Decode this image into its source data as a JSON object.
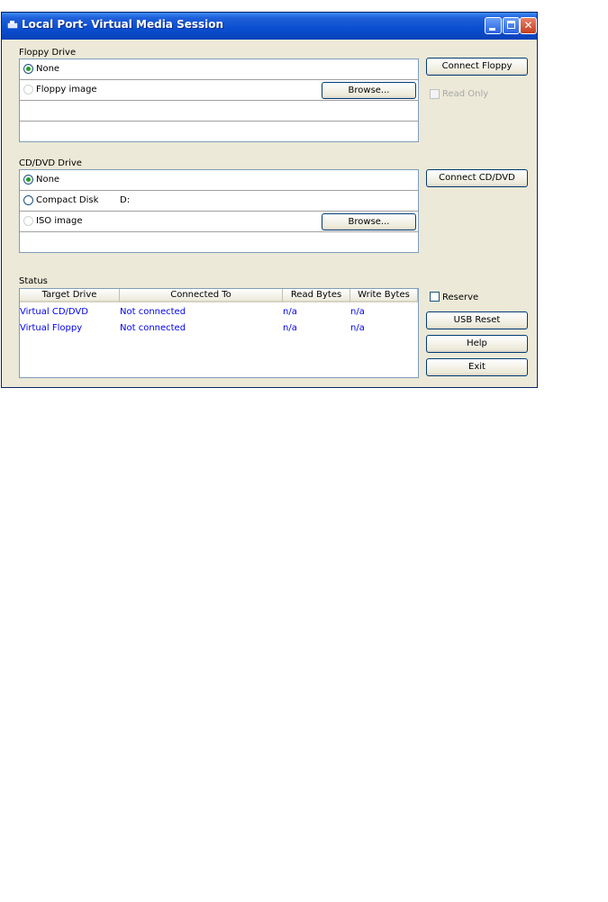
{
  "window": {
    "title": "Local Port- Virtual Media Session",
    "icon": "network-drive-icon"
  },
  "floppy": {
    "group_label": "Floppy Drive",
    "options": [
      {
        "label": "None",
        "selected": true
      },
      {
        "label": "Floppy image",
        "selected": false
      }
    ],
    "browse_label": "Browse...",
    "connect_label": "Connect Floppy",
    "read_only_label": "Read Only",
    "read_only_checked": false,
    "read_only_enabled": false
  },
  "cddvd": {
    "group_label": "CD/DVD Drive",
    "options": [
      {
        "label": "None",
        "selected": true
      },
      {
        "label": "Compact Disk",
        "selected": false,
        "value": "D:"
      },
      {
        "label": "ISO image",
        "selected": false
      }
    ],
    "browse_label": "Browse...",
    "connect_label": "Connect CD/DVD"
  },
  "status": {
    "group_label": "Status",
    "columns": [
      "Target Drive",
      "Connected To",
      "Read Bytes",
      "Write Bytes"
    ],
    "rows": [
      [
        "Virtual CD/DVD",
        "Not connected",
        "n/a",
        "n/a"
      ],
      [
        "Virtual Floppy",
        "Not connected",
        "n/a",
        "n/a"
      ]
    ],
    "reserve_label": "Reserve",
    "reserve_checked": false
  },
  "buttons": {
    "usb_reset": "USB Reset",
    "help": "Help",
    "exit": "Exit"
  },
  "colors": {
    "titlebar": "#0a4ed0",
    "table_text": "#0000ee",
    "radio_selected": "#21a121"
  }
}
